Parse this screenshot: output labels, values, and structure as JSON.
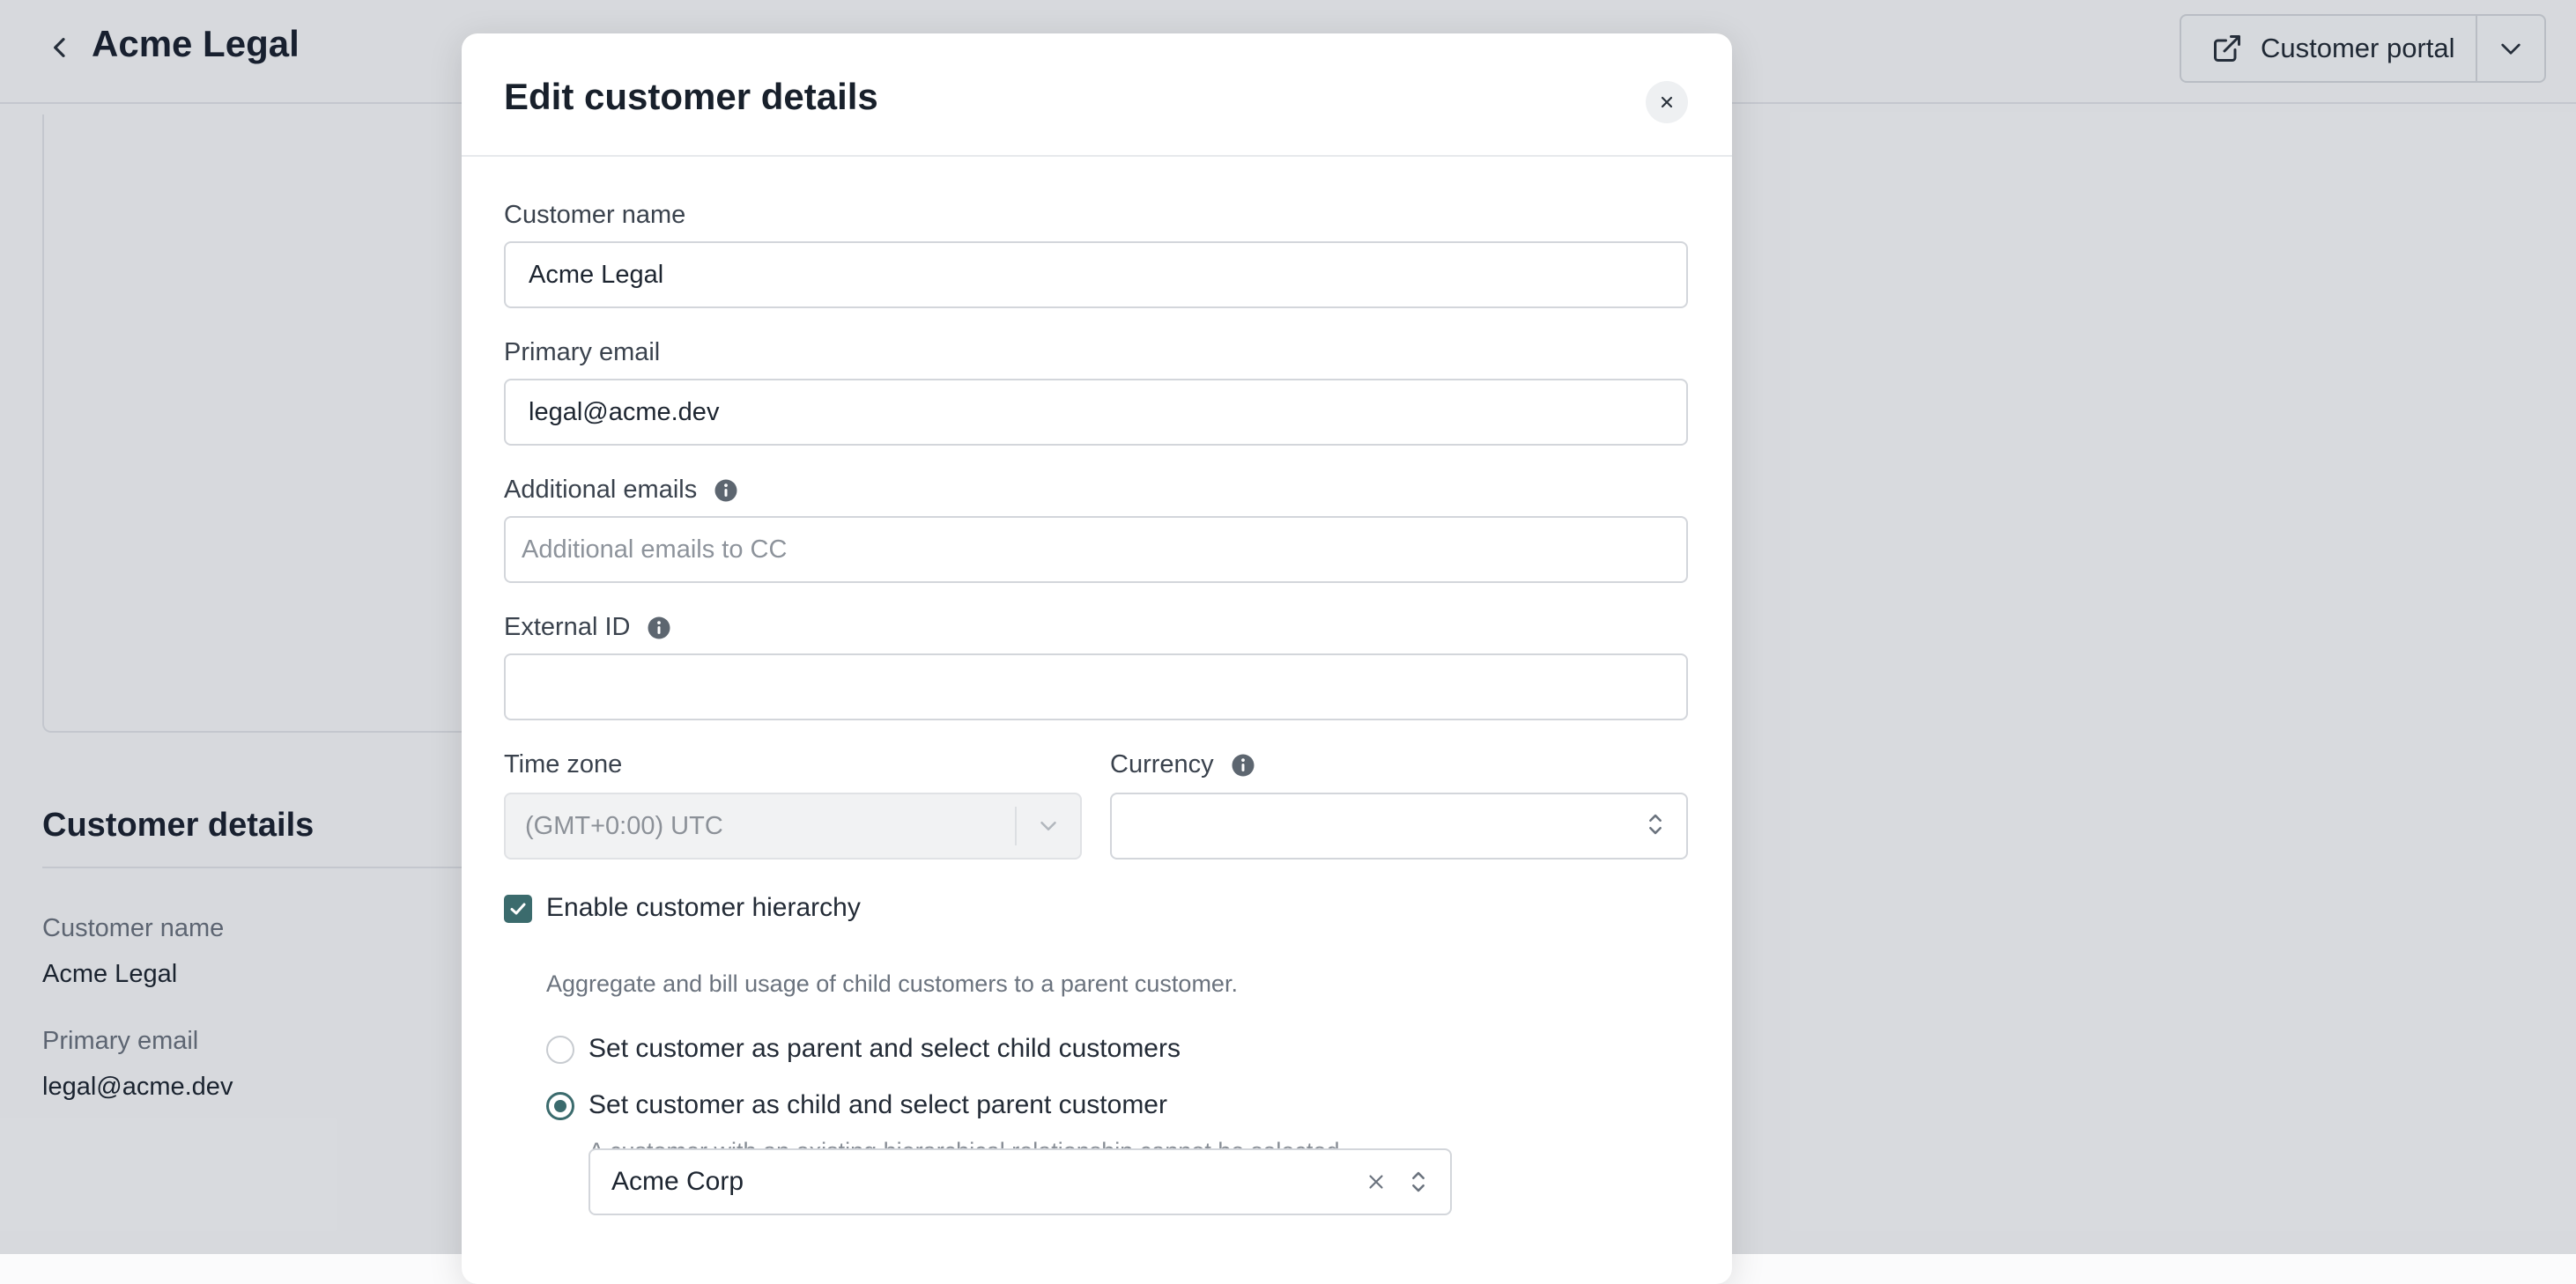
{
  "page": {
    "title": "Acme Legal",
    "portal_button_label": "Customer portal",
    "section_title": "Customer details",
    "details": [
      {
        "label": "Customer name",
        "value": "Acme Legal"
      },
      {
        "label": "Primary email",
        "value": "legal@acme.dev"
      }
    ]
  },
  "modal": {
    "title": "Edit customer details",
    "fields": {
      "customer_name": {
        "label": "Customer name",
        "value": "Acme Legal"
      },
      "primary_email": {
        "label": "Primary email",
        "value": "legal@acme.dev"
      },
      "additional_emails": {
        "label": "Additional emails",
        "placeholder": "Additional emails to CC",
        "value": ""
      },
      "external_id": {
        "label": "External ID",
        "value": ""
      },
      "time_zone": {
        "label": "Time zone",
        "value": "(GMT+0:00) UTC"
      },
      "currency": {
        "label": "Currency",
        "value": ""
      }
    },
    "hierarchy": {
      "checkbox_label": "Enable customer hierarchy",
      "checked": true,
      "description": "Aggregate and bill usage of child customers to a parent customer.",
      "options": [
        {
          "label": "Set customer as parent and select child customers",
          "selected": false
        },
        {
          "label": "Set customer as child and select parent customer",
          "selected": true
        }
      ],
      "child_help": "A customer with an existing hierarchical relationship cannot be selected.",
      "parent_customer": "Acme Corp"
    }
  },
  "colors": {
    "accent": "#3b6b6d",
    "overlay": "rgba(16,30,48,0.15)"
  },
  "icons": [
    "chevron-left-icon",
    "external-link-icon",
    "chevron-down-icon",
    "close-icon",
    "info-icon",
    "check-icon",
    "up-down-icon",
    "clear-icon"
  ]
}
